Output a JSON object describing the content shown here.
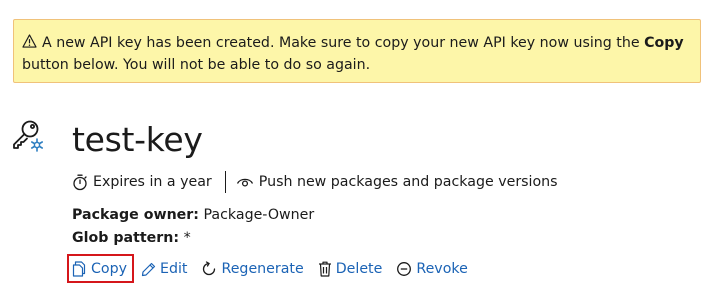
{
  "banner": {
    "icon": "warning-icon",
    "text_before": "A new API key has been created. Make sure to copy your new API key now using the ",
    "bold_word": "Copy",
    "text_after": " button below. You will not be able to do so again.",
    "colors": {
      "background": "#fdf6a9",
      "border": "#f0c27a"
    }
  },
  "key": {
    "icon": "key-icon",
    "name": "test-key",
    "expiry": {
      "icon": "timer-icon",
      "text": "Expires in a year"
    },
    "scope": {
      "icon": "eye-icon",
      "text": "Push new packages and package versions"
    },
    "package_owner": {
      "label": "Package owner:",
      "value": "Package-Owner"
    },
    "glob_pattern": {
      "label": "Glob pattern:",
      "value": "*"
    }
  },
  "actions": [
    {
      "label": "Copy",
      "icon": "copy-icon",
      "highlighted": true
    },
    {
      "label": "Edit",
      "icon": "pencil-icon"
    },
    {
      "label": "Regenerate",
      "icon": "refresh-icon"
    },
    {
      "label": "Delete",
      "icon": "trash-icon"
    },
    {
      "label": "Revoke",
      "icon": "minus-circle-icon"
    }
  ],
  "colors": {
    "link": "#1b63b5",
    "highlight": "#d5161b",
    "key_accent": "#2e7fc1"
  }
}
